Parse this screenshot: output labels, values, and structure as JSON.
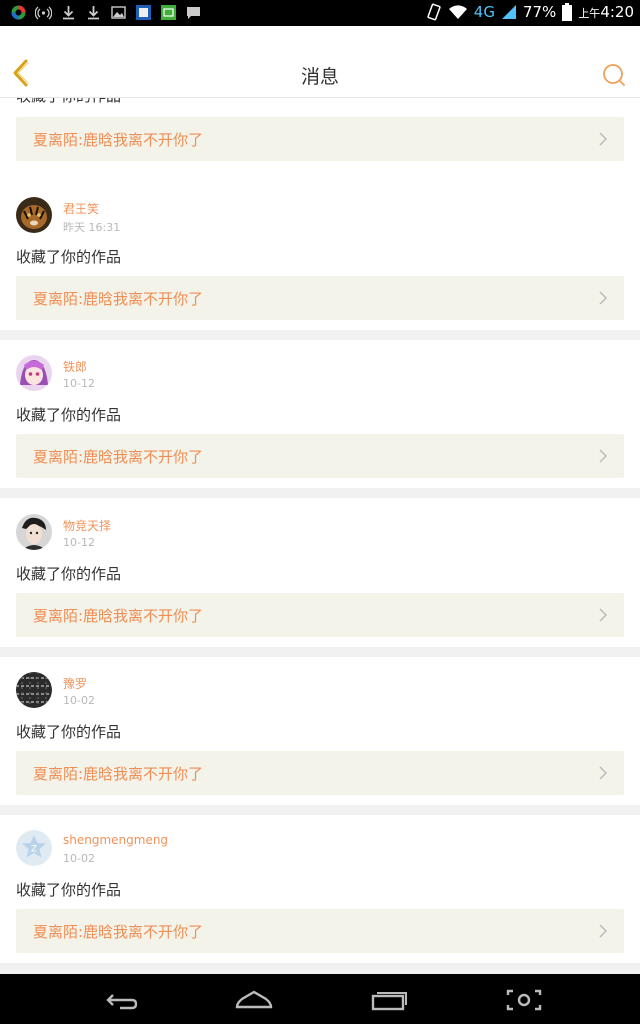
{
  "status_bar": {
    "battery": "77%",
    "network": "4G",
    "time_prefix": "上午",
    "time": "4:20"
  },
  "header": {
    "title": "消息"
  },
  "top_partial": {
    "action": "收藏了你的作品",
    "work_title": "夏离陌:鹿晗我离不开你了"
  },
  "messages": [
    {
      "user": "君王笑",
      "time": "昨天 16:31",
      "action": "收藏了你的作品",
      "work_title": "夏离陌:鹿晗我离不开你了",
      "avatar": "tiger"
    },
    {
      "user": "铁郎",
      "time": "10-12",
      "action": "收藏了你的作品",
      "work_title": "夏离陌:鹿晗我离不开你了",
      "avatar": "anime"
    },
    {
      "user": "物竞天择",
      "time": "10-12",
      "action": "收藏了你的作品",
      "work_title": "夏离陌:鹿晗我离不开你了",
      "avatar": "portrait"
    },
    {
      "user": "豫罗",
      "time": "10-02",
      "action": "收藏了你的作品",
      "work_title": "夏离陌:鹿晗我离不开你了",
      "avatar": "pattern"
    },
    {
      "user": "shengmengmeng",
      "time": "10-02",
      "action": "收藏了你的作品",
      "work_title": "夏离陌:鹿晗我离不开你了",
      "avatar": "default"
    }
  ],
  "colors": {
    "accent": "#ef8e54",
    "username": "#f0935b",
    "link_bg": "#f3f3ea",
    "page_bg": "#f1f1f1"
  },
  "icons": {
    "back": "chevron-left-icon",
    "search": "search-icon",
    "nav_back": "back-arrow-icon",
    "nav_home": "home-icon",
    "nav_recent": "recent-apps-icon",
    "nav_screenshot": "screenshot-icon"
  }
}
